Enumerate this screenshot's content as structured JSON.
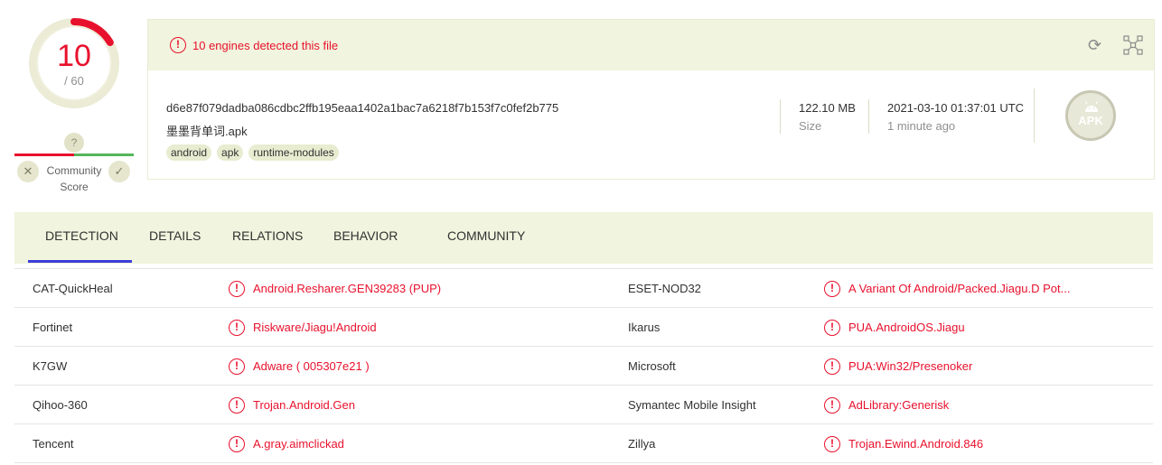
{
  "score": {
    "detections": "10",
    "total": "/ 60",
    "accent_color": "#e8112d",
    "ratio": 0.1667
  },
  "community_score": {
    "unknown_mark": "?",
    "label": "Community Score",
    "vote_down_icon": "x-icon",
    "vote_up_icon": "check-icon"
  },
  "header": {
    "alert_text": "10 engines detected this file",
    "alert_icon": "!",
    "hash": "d6e87f079dadba086cdbc2ffb195eaa1402a1bac7a6218f7b153f7c0fef2b775",
    "filename": "墨墨背单词.apk",
    "tags": [
      "android",
      "apk",
      "runtime-modules"
    ],
    "size_value": "122.10 MB",
    "size_label": "Size",
    "date_value": "2021-03-10 01:37:01 UTC",
    "date_label": "1 minute ago",
    "file_type": "APK"
  },
  "tabs": [
    {
      "label": "DETECTION",
      "active": true
    },
    {
      "label": "DETAILS",
      "active": false
    },
    {
      "label": "RELATIONS",
      "active": false
    },
    {
      "label": "BEHAVIOR",
      "active": false
    },
    {
      "label": "COMMUNITY",
      "active": false
    }
  ],
  "detections": [
    {
      "engine_left": "CAT-QuickHeal",
      "result_left": "Android.Resharer.GEN39283 (PUP)",
      "engine_right": "ESET-NOD32",
      "result_right": "A Variant Of Android/Packed.Jiagu.D Pot..."
    },
    {
      "engine_left": "Fortinet",
      "result_left": "Riskware/Jiagu!Android",
      "engine_right": "Ikarus",
      "result_right": "PUA.AndroidOS.Jiagu"
    },
    {
      "engine_left": "K7GW",
      "result_left": "Adware ( 005307e21 )",
      "engine_right": "Microsoft",
      "result_right": "PUA:Win32/Presenoker"
    },
    {
      "engine_left": "Qihoo-360",
      "result_left": "Trojan.Android.Gen",
      "engine_right": "Symantec Mobile Insight",
      "result_right": "AdLibrary:Generisk"
    },
    {
      "engine_left": "Tencent",
      "result_left": "A.gray.aimclickad",
      "engine_right": "Zillya",
      "result_right": "Trojan.Ewind.Android.846"
    }
  ]
}
